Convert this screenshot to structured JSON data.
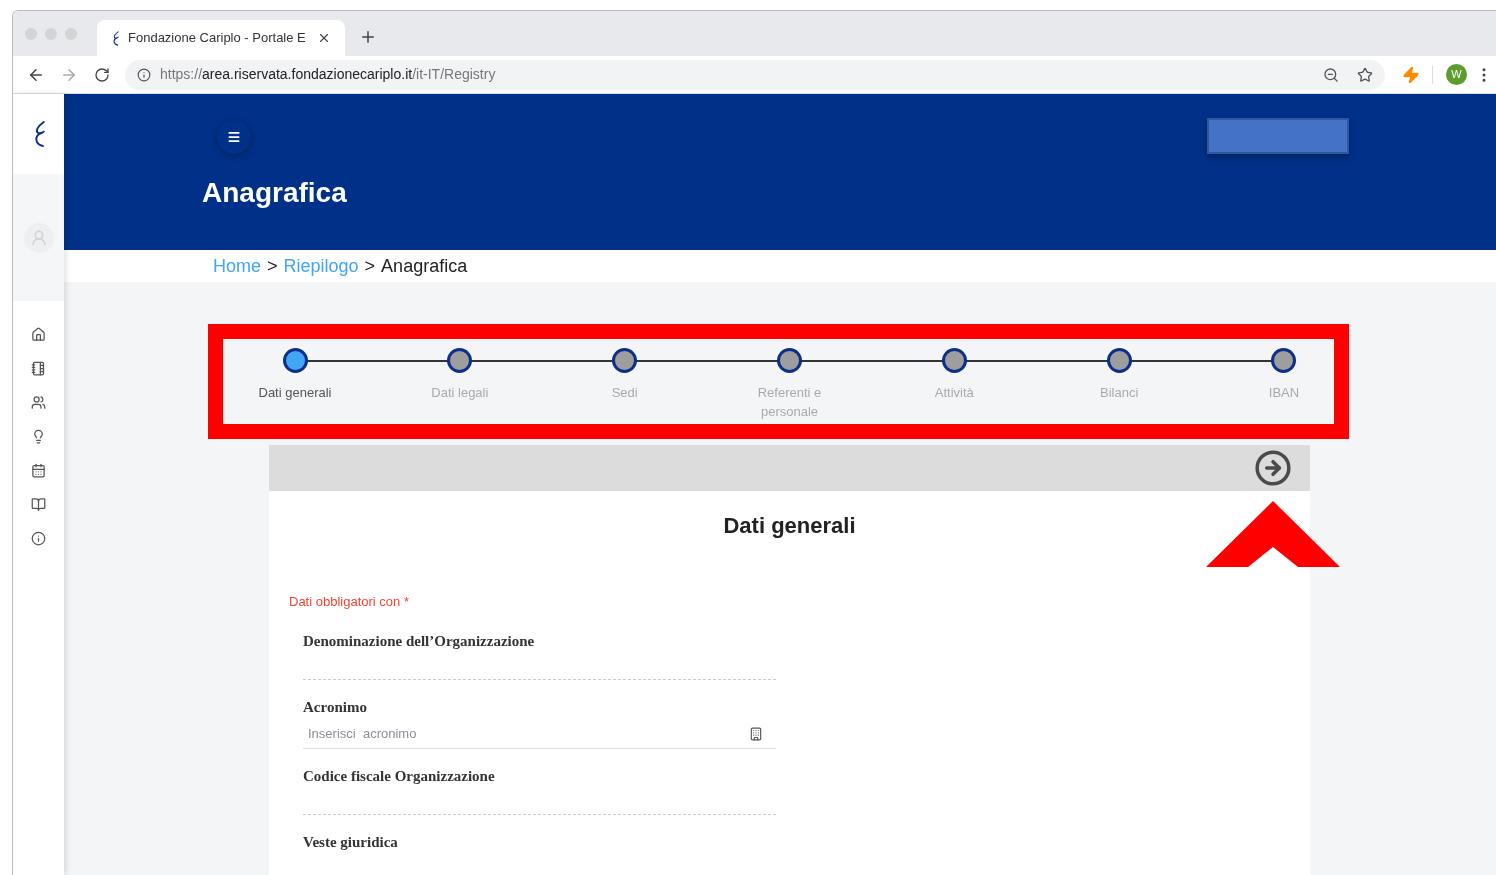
{
  "browser": {
    "tab_title": "Fondazione Cariplo - Portale E",
    "url": {
      "scheme": "https://",
      "host": "area.riservata.fondazionecariplo.it",
      "path": "/it-IT/Registry"
    },
    "profile": "W"
  },
  "header": {
    "title": "Anagrafica"
  },
  "breadcrumb": [
    {
      "label": "Home",
      "kind": "link"
    },
    {
      "label": ">",
      "kind": "sep"
    },
    {
      "label": "Riepilogo",
      "kind": "link"
    },
    {
      "label": ">",
      "kind": "sep"
    },
    {
      "label": "Anagrafica",
      "kind": "current"
    }
  ],
  "steps": [
    {
      "label": "Dati generali",
      "selected": true
    },
    {
      "label": "Dati legali",
      "selected": false
    },
    {
      "label": "Sedi",
      "selected": false
    },
    {
      "label": "Referenti e personale",
      "selected": false
    },
    {
      "label": "Attività",
      "selected": false
    },
    {
      "label": "Bilanci",
      "selected": false
    },
    {
      "label": "IBAN",
      "selected": false
    }
  ],
  "card": {
    "title": "Dati generali",
    "required_note": "Dati obbligatori con *",
    "fields": [
      {
        "kind": "static",
        "label": "Denominazione dell’Organizzazione"
      },
      {
        "kind": "input",
        "label": "Acronimo",
        "placeholder": "Inserisci  acronimo"
      },
      {
        "kind": "static",
        "label": "Codice fiscale Organizzazione"
      },
      {
        "kind": "static",
        "label": "Veste giuridica"
      }
    ]
  }
}
